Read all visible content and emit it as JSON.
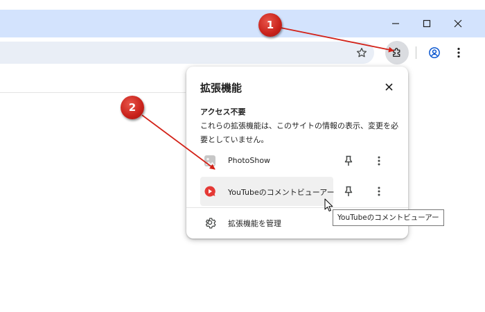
{
  "window": {
    "buttons": {
      "minimize": "minimize-icon",
      "maximize": "maximize-icon",
      "close": "close-icon"
    }
  },
  "toolbar": {
    "icons": [
      "star-icon",
      "puzzle-icon",
      "profile-icon",
      "kebab-menu-icon"
    ]
  },
  "popup": {
    "title": "拡張機能",
    "section_title": "アクセス不要",
    "section_desc": "これらの拡張機能は、このサイトの情報の表示、変更を必要としていません。",
    "extensions": [
      {
        "name": "PhotoShow",
        "icon": "photo-icon"
      },
      {
        "name": "YouTubeのコメントビューアー",
        "icon": "youtube-comment-icon"
      }
    ],
    "manage_label": "拡張機能を管理"
  },
  "tooltip": {
    "text": "YouTubeのコメントビューアー"
  },
  "callouts": {
    "one": "1",
    "two": "2"
  },
  "colors": {
    "titlebar": "#d3e3fd",
    "omnibox": "#e9eef6",
    "callout": "#c8211a",
    "accent": "#0b57d0"
  }
}
